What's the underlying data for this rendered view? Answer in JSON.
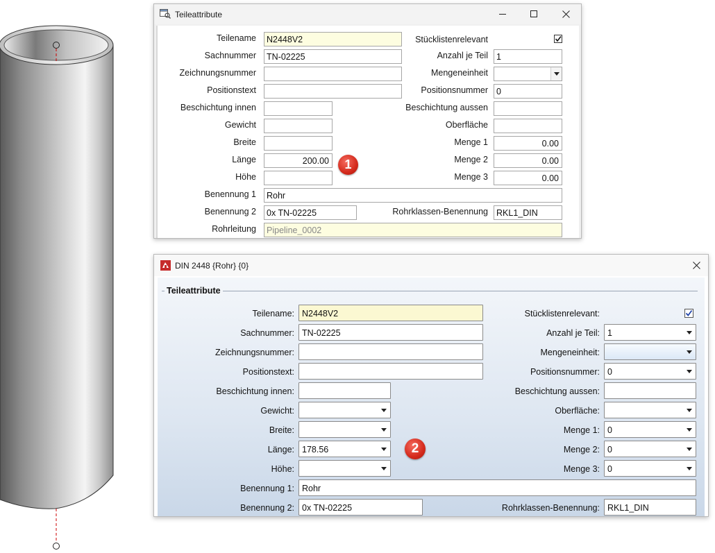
{
  "window1": {
    "title": "Teileattribute",
    "labels": {
      "teilename": "Teilename",
      "sachnummer": "Sachnummer",
      "zeichnungsnummer": "Zeichnungsnummer",
      "positionstext": "Positionstext",
      "beschichtung_innen": "Beschichtung innen",
      "gewicht": "Gewicht",
      "breite": "Breite",
      "laenge": "Länge",
      "hoehe": "Höhe",
      "benennung1": "Benennung 1",
      "benennung2": "Benennung 2",
      "rohrleitung": "Rohrleitung",
      "stuecklistenrelevant": "Stücklistenrelevant",
      "anzahl_je_teil": "Anzahl je Teil",
      "mengeneinheit": "Mengeneinheit",
      "positionsnummer": "Positionsnummer",
      "beschichtung_aussen": "Beschichtung aussen",
      "oberflaeche": "Oberfläche",
      "menge1": "Menge 1",
      "menge2": "Menge 2",
      "menge3": "Menge 3",
      "rohrklassen_benennung": "Rohrklassen-Benennung"
    },
    "values": {
      "teilename": "N2448V2",
      "sachnummer": "TN-02225",
      "zeichnungsnummer": "",
      "positionstext": "",
      "beschichtung_innen": "",
      "gewicht": "",
      "breite": "",
      "laenge": "200.00",
      "hoehe": "",
      "benennung1": "Rohr",
      "benennung2": "0x TN-02225",
      "rohrleitung": "Pipeline_0002",
      "anzahl_je_teil": "1",
      "mengeneinheit": "",
      "positionsnummer": "0",
      "beschichtung_aussen": "",
      "oberflaeche": "",
      "menge1": "0.00",
      "menge2": "0.00",
      "menge3": "0.00",
      "rohrklassen_benennung": "RKL1_DIN"
    },
    "stuecklistenrelevant_checked": true,
    "badge": "1"
  },
  "window2": {
    "title": "DIN 2448 {Rohr} {0}",
    "group_title": "Teileattribute",
    "labels": {
      "teilename": "Teilename:",
      "sachnummer": "Sachnummer:",
      "zeichnungsnummer": "Zeichnungsnummer:",
      "positionstext": "Positionstext:",
      "beschichtung_innen": "Beschichtung innen:",
      "gewicht": "Gewicht:",
      "breite": "Breite:",
      "laenge": "Länge:",
      "hoehe": "Höhe:",
      "benennung1": "Benennung 1:",
      "benennung2": "Benennung 2:",
      "stuecklistenrelevant": "Stücklistenrelevant:",
      "anzahl_je_teil": "Anzahl je Teil:",
      "mengeneinheit": "Mengeneinheit:",
      "positionsnummer": "Positionsnummer:",
      "beschichtung_aussen": "Beschichtung aussen:",
      "oberflaeche": "Oberfläche:",
      "menge1": "Menge 1:",
      "menge2": "Menge 2:",
      "menge3": "Menge 3:",
      "rohrklassen_benennung": "Rohrklassen-Benennung:"
    },
    "values": {
      "teilename": "N2448V2",
      "sachnummer": "TN-02225",
      "zeichnungsnummer": "",
      "positionstext": "",
      "beschichtung_innen": "",
      "gewicht": "",
      "breite": "",
      "laenge": "178.56",
      "hoehe": "",
      "benennung1": "Rohr",
      "benennung2": "0x TN-02225",
      "anzahl_je_teil": "1",
      "mengeneinheit": "",
      "positionsnummer": "0",
      "beschichtung_aussen": "",
      "oberflaeche": "",
      "menge1": "0",
      "menge2": "0",
      "menge3": "0",
      "rohrklassen_benennung": "RKL1_DIN"
    },
    "stuecklistenrelevant_checked": true,
    "badge": "2"
  },
  "colors": {
    "badge_red": "#d42a1c",
    "yellow_field": "#fdfde0",
    "blue_gradient_end": "#c9d7e8"
  }
}
